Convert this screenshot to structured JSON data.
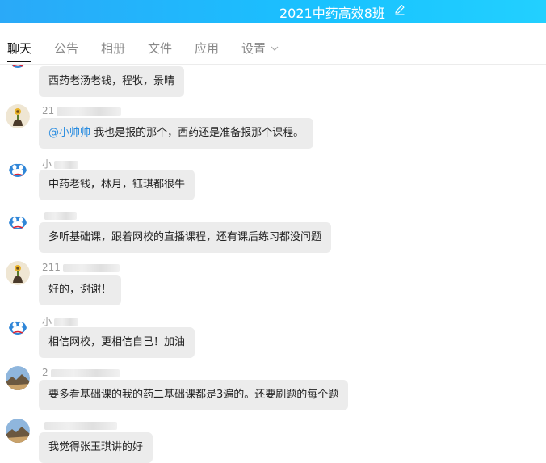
{
  "window": {
    "title": "2021中药高效8班",
    "edit_icon": "pencil-icon"
  },
  "tabs": [
    {
      "label": "聊天",
      "active": true
    },
    {
      "label": "公告"
    },
    {
      "label": "相册"
    },
    {
      "label": "文件"
    },
    {
      "label": "应用"
    },
    {
      "label": "设置",
      "has_dropdown": true
    }
  ],
  "messages": [
    {
      "sender": "",
      "avatar": "cartoon-avatar",
      "text": "西药老汤老钱，程牧，景晴"
    },
    {
      "sender": "21",
      "avatar": "flower-avatar",
      "mention": "@小帅帅",
      "text": " 我也是报的那个，西药还是准备报那个课程。"
    },
    {
      "sender": "小",
      "avatar": "cartoon-avatar",
      "text": "中药老钱，林月，钰琪都很牛"
    },
    {
      "sender": "",
      "avatar": "cartoon-avatar",
      "text": "多听基础课，跟着网校的直播课程，还有课后练习都没问题"
    },
    {
      "sender": "211",
      "avatar": "flower-avatar",
      "text": "好的，谢谢！"
    },
    {
      "sender": "小",
      "avatar": "cartoon-avatar",
      "text": "相信网校，更相信自己！加油"
    },
    {
      "sender": "2",
      "avatar": "landscape-avatar",
      "text": "要多看基础课的我的药二基础课都是3遍的。还要刷题的每个题"
    },
    {
      "sender": "",
      "avatar": "landscape-avatar",
      "text": "我觉得张玉琪讲的好"
    }
  ],
  "colors": {
    "titlebar": "#19c2ff",
    "bubble": "#ececec",
    "mention": "#2b8de0"
  }
}
